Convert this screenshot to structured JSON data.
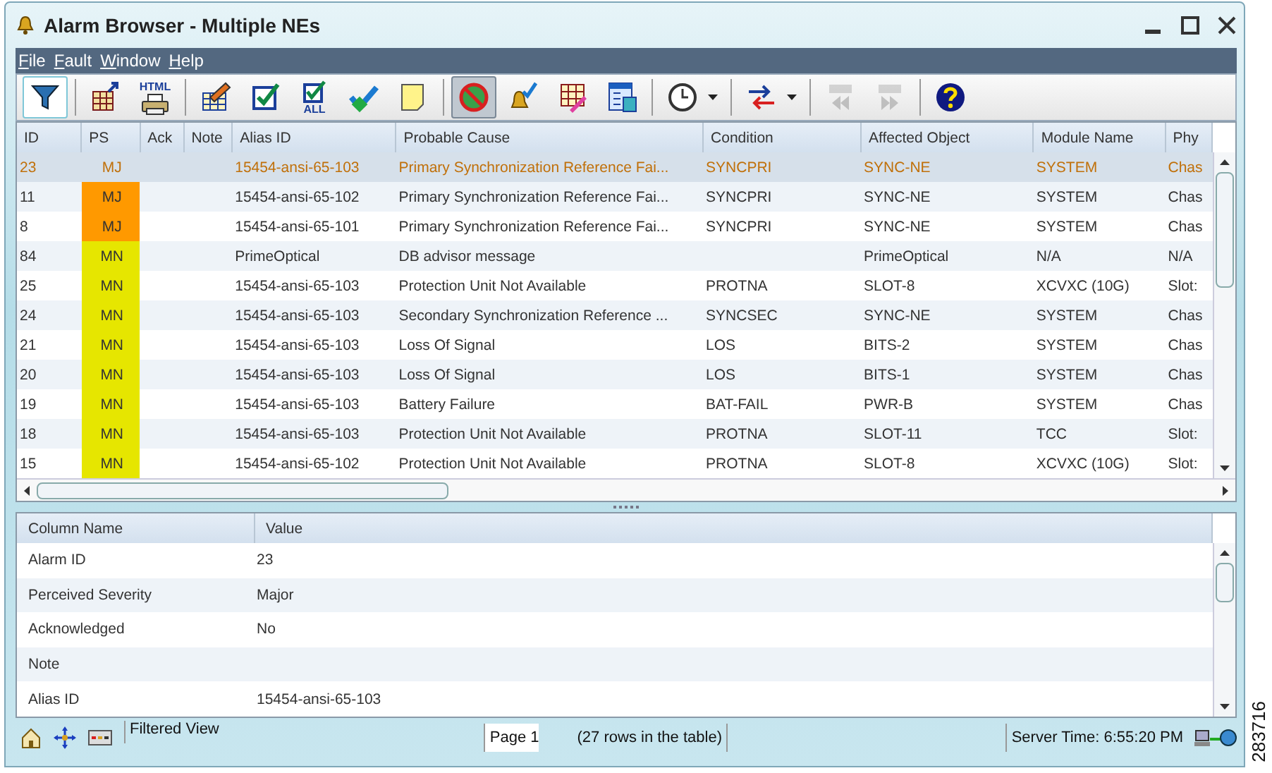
{
  "window": {
    "title": "Alarm Browser - Multiple NEs"
  },
  "menu": [
    "File",
    "Fault",
    "Window",
    "Help"
  ],
  "toolbar": [
    [
      {
        "kind": "filter",
        "pressed": false,
        "focused": true
      }
    ],
    [
      {
        "kind": "export",
        "pressed": false,
        "focused": false
      },
      {
        "kind": "html",
        "label": "HTML",
        "pressed": false,
        "focused": false
      }
    ],
    [
      {
        "kind": "edit",
        "pressed": false,
        "focused": false
      },
      {
        "kind": "check",
        "pressed": false,
        "focused": false
      },
      {
        "kind": "checkall",
        "label": "ALL",
        "pressed": false,
        "focused": false
      },
      {
        "kind": "checkmark",
        "pressed": false,
        "focused": false
      },
      {
        "kind": "note",
        "pressed": false,
        "focused": false
      }
    ],
    [
      {
        "kind": "noentry",
        "pressed": true,
        "focused": false
      },
      {
        "kind": "bell",
        "pressed": false,
        "focused": false
      },
      {
        "kind": "gridpencil",
        "pressed": false,
        "focused": false
      },
      {
        "kind": "table",
        "pressed": false,
        "focused": false
      }
    ],
    [
      {
        "kind": "clock",
        "pressed": false,
        "focused": false,
        "dropdown": true
      }
    ],
    [
      {
        "kind": "arrows",
        "pressed": false,
        "focused": false,
        "dropdown": true
      }
    ],
    [
      {
        "kind": "prev",
        "pressed": false,
        "focused": false,
        "disabled": true
      },
      {
        "kind": "next",
        "pressed": false,
        "focused": false,
        "disabled": true
      }
    ],
    [
      {
        "kind": "help",
        "pressed": false,
        "focused": false
      }
    ]
  ],
  "alarm_table": {
    "columns": [
      "ID",
      "PS",
      "Ack",
      "Note",
      "Alias ID",
      "Probable Cause",
      "Condition",
      "Affected Object",
      "Module Name",
      "Phy"
    ],
    "rows": [
      {
        "selected": true,
        "cells": [
          "23",
          "MJ",
          "",
          "",
          "15454-ansi-65-103",
          "Primary Synchronization Reference Fai...",
          "SYNCPRI",
          "SYNC-NE",
          "SYSTEM",
          "Chas"
        ]
      },
      {
        "selected": false,
        "color": "#ff9900",
        "cells": [
          "11",
          "MJ",
          "",
          "",
          "15454-ansi-65-102",
          "Primary Synchronization Reference Fai...",
          "SYNCPRI",
          "SYNC-NE",
          "SYSTEM",
          "Chas"
        ]
      },
      {
        "selected": false,
        "color": "#ff9900",
        "cells": [
          "8",
          "MJ",
          "",
          "",
          "15454-ansi-65-101",
          "Primary Synchronization Reference Fai...",
          "SYNCPRI",
          "SYNC-NE",
          "SYSTEM",
          "Chas"
        ]
      },
      {
        "selected": false,
        "color": "#e6e600",
        "cells": [
          "84",
          "MN",
          "",
          "",
          "PrimeOptical",
          "DB advisor message",
          "",
          "PrimeOptical",
          "N/A",
          "N/A"
        ]
      },
      {
        "selected": false,
        "color": "#e6e600",
        "cells": [
          "25",
          "MN",
          "",
          "",
          "15454-ansi-65-103",
          "Protection Unit Not Available",
          "PROTNA",
          "SLOT-8",
          "XCVXC (10G)",
          "Slot:"
        ]
      },
      {
        "selected": false,
        "color": "#e6e600",
        "cells": [
          "24",
          "MN",
          "",
          "",
          "15454-ansi-65-103",
          "Secondary Synchronization Reference ...",
          "SYNCSEC",
          "SYNC-NE",
          "SYSTEM",
          "Chas"
        ]
      },
      {
        "selected": false,
        "color": "#e6e600",
        "cells": [
          "21",
          "MN",
          "",
          "",
          "15454-ansi-65-103",
          "Loss Of Signal",
          "LOS",
          "BITS-2",
          "SYSTEM",
          "Chas"
        ]
      },
      {
        "selected": false,
        "color": "#e6e600",
        "cells": [
          "20",
          "MN",
          "",
          "",
          "15454-ansi-65-103",
          "Loss Of Signal",
          "LOS",
          "BITS-1",
          "SYSTEM",
          "Chas"
        ]
      },
      {
        "selected": false,
        "color": "#e6e600",
        "cells": [
          "19",
          "MN",
          "",
          "",
          "15454-ansi-65-103",
          "Battery Failure",
          "BAT-FAIL",
          "PWR-B",
          "SYSTEM",
          "Chas"
        ]
      },
      {
        "selected": false,
        "color": "#e6e600",
        "cells": [
          "18",
          "MN",
          "",
          "",
          "15454-ansi-65-103",
          "Protection Unit Not Available",
          "PROTNA",
          "SLOT-11",
          "TCC",
          "Slot:"
        ]
      },
      {
        "selected": false,
        "color": "#e6e600",
        "cells": [
          "15",
          "MN",
          "",
          "",
          "15454-ansi-65-102",
          "Protection Unit Not Available",
          "PROTNA",
          "SLOT-8",
          "XCVXC (10G)",
          "Slot:"
        ]
      }
    ]
  },
  "details_table": {
    "columns": [
      "Column Name",
      "Value"
    ],
    "rows": [
      [
        "Alarm ID",
        "23"
      ],
      [
        "Perceived Severity",
        "Major"
      ],
      [
        "Acknowledged",
        "No"
      ],
      [
        "Note",
        ""
      ],
      [
        "Alias ID",
        "15454-ansi-65-103"
      ]
    ]
  },
  "status_bar": {
    "view": "Filtered View",
    "page": "Page 1",
    "rows": "(27  rows in the table)",
    "server_time": "Server Time: 6:55:20 PM"
  },
  "figure_number": "283716"
}
